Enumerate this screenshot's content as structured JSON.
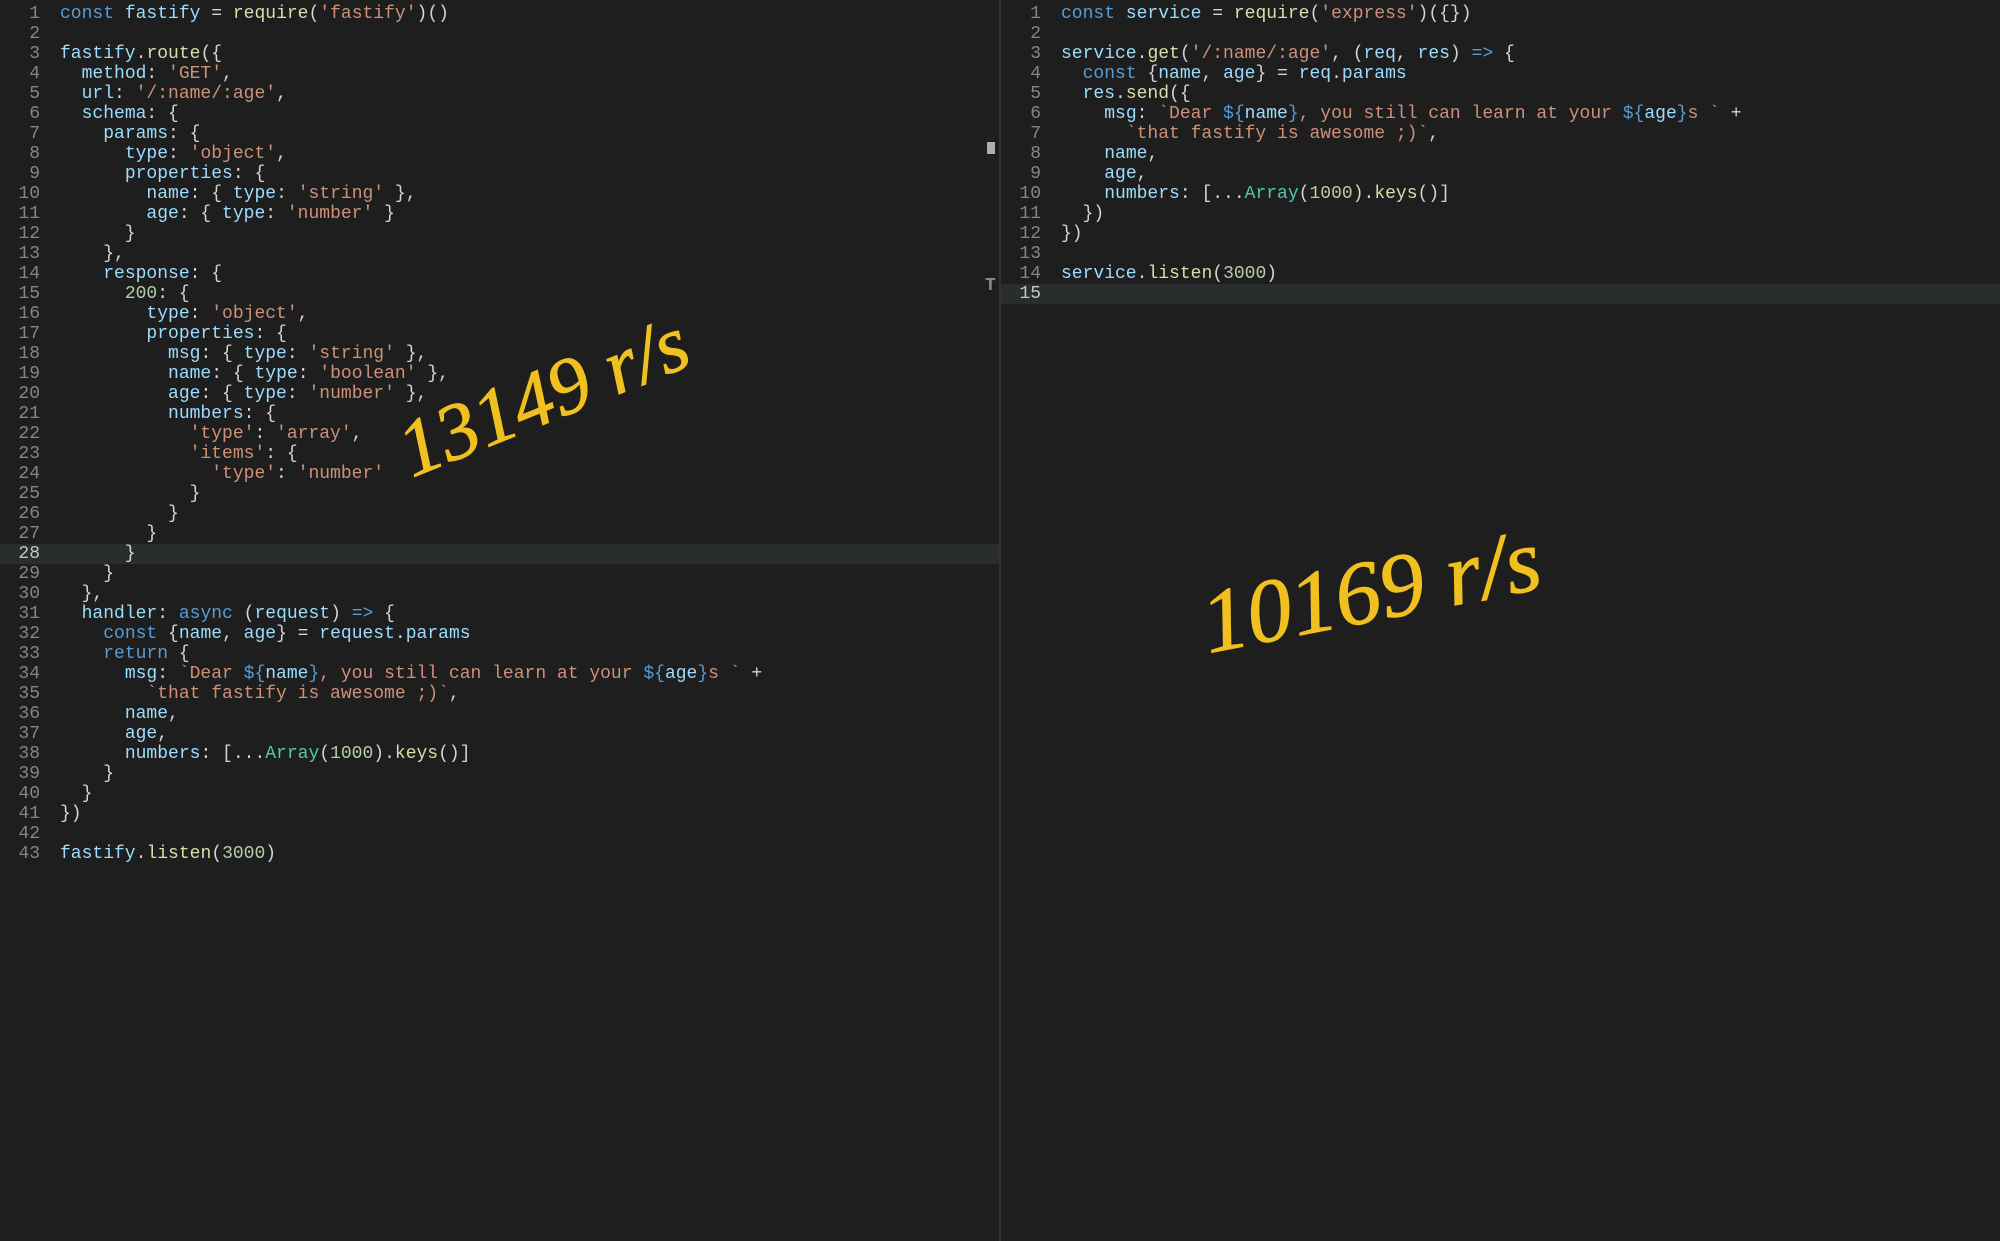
{
  "annotations": {
    "left": "13149 r/s",
    "right": "10169 r/s"
  },
  "left": {
    "highlight_line": 28,
    "lines": [
      [
        [
          "kw",
          "const"
        ],
        [
          "pun",
          " "
        ],
        [
          "var",
          "fastify"
        ],
        [
          "pun",
          " = "
        ],
        [
          "fn",
          "require"
        ],
        [
          "pun",
          "("
        ],
        [
          "str",
          "'fastify'"
        ],
        [
          "pun",
          ")()"
        ]
      ],
      [],
      [
        [
          "var",
          "fastify"
        ],
        [
          "pun",
          "."
        ],
        [
          "fn",
          "route"
        ],
        [
          "pun",
          "({"
        ]
      ],
      [
        [
          "pun",
          "  "
        ],
        [
          "var",
          "method"
        ],
        [
          "pun",
          ": "
        ],
        [
          "str",
          "'GET'"
        ],
        [
          "pun",
          ","
        ]
      ],
      [
        [
          "pun",
          "  "
        ],
        [
          "var",
          "url"
        ],
        [
          "pun",
          ": "
        ],
        [
          "str",
          "'/:name/:age'"
        ],
        [
          "pun",
          ","
        ]
      ],
      [
        [
          "pun",
          "  "
        ],
        [
          "var",
          "schema"
        ],
        [
          "pun",
          ": {"
        ]
      ],
      [
        [
          "pun",
          "    "
        ],
        [
          "var",
          "params"
        ],
        [
          "pun",
          ": {"
        ]
      ],
      [
        [
          "pun",
          "      "
        ],
        [
          "var",
          "type"
        ],
        [
          "pun",
          ": "
        ],
        [
          "str",
          "'object'"
        ],
        [
          "pun",
          ","
        ]
      ],
      [
        [
          "pun",
          "      "
        ],
        [
          "var",
          "properties"
        ],
        [
          "pun",
          ": {"
        ]
      ],
      [
        [
          "pun",
          "        "
        ],
        [
          "var",
          "name"
        ],
        [
          "pun",
          ": { "
        ],
        [
          "var",
          "type"
        ],
        [
          "pun",
          ": "
        ],
        [
          "str",
          "'string'"
        ],
        [
          "pun",
          " },"
        ]
      ],
      [
        [
          "pun",
          "        "
        ],
        [
          "var",
          "age"
        ],
        [
          "pun",
          ": { "
        ],
        [
          "var",
          "type"
        ],
        [
          "pun",
          ": "
        ],
        [
          "str",
          "'number'"
        ],
        [
          "pun",
          " }"
        ]
      ],
      [
        [
          "pun",
          "      }"
        ]
      ],
      [
        [
          "pun",
          "    },"
        ]
      ],
      [
        [
          "pun",
          "    "
        ],
        [
          "var",
          "response"
        ],
        [
          "pun",
          ": {"
        ]
      ],
      [
        [
          "pun",
          "      "
        ],
        [
          "num",
          "200"
        ],
        [
          "pun",
          ": {"
        ]
      ],
      [
        [
          "pun",
          "        "
        ],
        [
          "var",
          "type"
        ],
        [
          "pun",
          ": "
        ],
        [
          "str",
          "'object'"
        ],
        [
          "pun",
          ","
        ]
      ],
      [
        [
          "pun",
          "        "
        ],
        [
          "var",
          "properties"
        ],
        [
          "pun",
          ": {"
        ]
      ],
      [
        [
          "pun",
          "          "
        ],
        [
          "var",
          "msg"
        ],
        [
          "pun",
          ": { "
        ],
        [
          "var",
          "type"
        ],
        [
          "pun",
          ": "
        ],
        [
          "str",
          "'string'"
        ],
        [
          "pun",
          " },"
        ]
      ],
      [
        [
          "pun",
          "          "
        ],
        [
          "var",
          "name"
        ],
        [
          "pun",
          ": { "
        ],
        [
          "var",
          "type"
        ],
        [
          "pun",
          ": "
        ],
        [
          "str",
          "'boolean'"
        ],
        [
          "pun",
          " },"
        ]
      ],
      [
        [
          "pun",
          "          "
        ],
        [
          "var",
          "age"
        ],
        [
          "pun",
          ": { "
        ],
        [
          "var",
          "type"
        ],
        [
          "pun",
          ": "
        ],
        [
          "str",
          "'number'"
        ],
        [
          "pun",
          " },"
        ]
      ],
      [
        [
          "pun",
          "          "
        ],
        [
          "var",
          "numbers"
        ],
        [
          "pun",
          ": {"
        ]
      ],
      [
        [
          "pun",
          "            "
        ],
        [
          "str",
          "'type'"
        ],
        [
          "pun",
          ": "
        ],
        [
          "str",
          "'array'"
        ],
        [
          "pun",
          ","
        ]
      ],
      [
        [
          "pun",
          "            "
        ],
        [
          "str",
          "'items'"
        ],
        [
          "pun",
          ": {"
        ]
      ],
      [
        [
          "pun",
          "              "
        ],
        [
          "str",
          "'type'"
        ],
        [
          "pun",
          ": "
        ],
        [
          "str",
          "'number'"
        ]
      ],
      [
        [
          "pun",
          "            }"
        ]
      ],
      [
        [
          "pun",
          "          }"
        ]
      ],
      [
        [
          "pun",
          "        }"
        ]
      ],
      [
        [
          "pun",
          "      }"
        ]
      ],
      [
        [
          "pun",
          "    }"
        ]
      ],
      [
        [
          "pun",
          "  },"
        ]
      ],
      [
        [
          "pun",
          "  "
        ],
        [
          "var",
          "handler"
        ],
        [
          "pun",
          ": "
        ],
        [
          "kw",
          "async"
        ],
        [
          "pun",
          " ("
        ],
        [
          "var",
          "request"
        ],
        [
          "pun",
          ") "
        ],
        [
          "tpl",
          "=>"
        ],
        [
          "pun",
          " {"
        ]
      ],
      [
        [
          "pun",
          "    "
        ],
        [
          "kw",
          "const"
        ],
        [
          "pun",
          " {"
        ],
        [
          "var",
          "name"
        ],
        [
          "pun",
          ", "
        ],
        [
          "var",
          "age"
        ],
        [
          "pun",
          "} = "
        ],
        [
          "var",
          "request"
        ],
        [
          "pun",
          "."
        ],
        [
          "var",
          "params"
        ]
      ],
      [
        [
          "pun",
          "    "
        ],
        [
          "kw",
          "return"
        ],
        [
          "pun",
          " {"
        ]
      ],
      [
        [
          "pun",
          "      "
        ],
        [
          "var",
          "msg"
        ],
        [
          "pun",
          ": "
        ],
        [
          "str",
          "`Dear "
        ],
        [
          "tpl",
          "${"
        ],
        [
          "var",
          "name"
        ],
        [
          "tpl",
          "}"
        ],
        [
          "str",
          ", you still can learn at your "
        ],
        [
          "tpl",
          "${"
        ],
        [
          "var",
          "age"
        ],
        [
          "tpl",
          "}"
        ],
        [
          "str",
          "s `"
        ],
        [
          "pun",
          " +"
        ]
      ],
      [
        [
          "pun",
          "        "
        ],
        [
          "str",
          "`that fastify is awesome ;)`"
        ],
        [
          "pun",
          ","
        ]
      ],
      [
        [
          "pun",
          "      "
        ],
        [
          "var",
          "name"
        ],
        [
          "pun",
          ","
        ]
      ],
      [
        [
          "pun",
          "      "
        ],
        [
          "var",
          "age"
        ],
        [
          "pun",
          ","
        ]
      ],
      [
        [
          "pun",
          "      "
        ],
        [
          "var",
          "numbers"
        ],
        [
          "pun",
          ": [..."
        ],
        [
          "cls",
          "Array"
        ],
        [
          "pun",
          "("
        ],
        [
          "num",
          "1000"
        ],
        [
          "pun",
          ")."
        ],
        [
          "fn",
          "keys"
        ],
        [
          "pun",
          "()]"
        ]
      ],
      [
        [
          "pun",
          "    }"
        ]
      ],
      [
        [
          "pun",
          "  }"
        ]
      ],
      [
        [
          "pun",
          "})"
        ]
      ],
      [],
      [
        [
          "var",
          "fastify"
        ],
        [
          "pun",
          "."
        ],
        [
          "fn",
          "listen"
        ],
        [
          "pun",
          "("
        ],
        [
          "num",
          "3000"
        ],
        [
          "pun",
          ")"
        ]
      ]
    ]
  },
  "right": {
    "highlight_line": 15,
    "lines": [
      [
        [
          "kw",
          "const"
        ],
        [
          "pun",
          " "
        ],
        [
          "var",
          "service"
        ],
        [
          "pun",
          " = "
        ],
        [
          "fn",
          "require"
        ],
        [
          "pun",
          "("
        ],
        [
          "str",
          "'express'"
        ],
        [
          "pun",
          ")({})"
        ]
      ],
      [],
      [
        [
          "var",
          "service"
        ],
        [
          "pun",
          "."
        ],
        [
          "fn",
          "get"
        ],
        [
          "pun",
          "("
        ],
        [
          "str",
          "'/:name/:age'"
        ],
        [
          "pun",
          ", ("
        ],
        [
          "var",
          "req"
        ],
        [
          "pun",
          ", "
        ],
        [
          "var",
          "res"
        ],
        [
          "pun",
          ") "
        ],
        [
          "tpl",
          "=>"
        ],
        [
          "pun",
          " {"
        ]
      ],
      [
        [
          "pun",
          "  "
        ],
        [
          "kw",
          "const"
        ],
        [
          "pun",
          " {"
        ],
        [
          "var",
          "name"
        ],
        [
          "pun",
          ", "
        ],
        [
          "var",
          "age"
        ],
        [
          "pun",
          "} = "
        ],
        [
          "var",
          "req"
        ],
        [
          "pun",
          "."
        ],
        [
          "var",
          "params"
        ]
      ],
      [
        [
          "pun",
          "  "
        ],
        [
          "var",
          "res"
        ],
        [
          "pun",
          "."
        ],
        [
          "fn",
          "send"
        ],
        [
          "pun",
          "({"
        ]
      ],
      [
        [
          "pun",
          "    "
        ],
        [
          "var",
          "msg"
        ],
        [
          "pun",
          ": "
        ],
        [
          "str",
          "`Dear "
        ],
        [
          "tpl",
          "${"
        ],
        [
          "var",
          "name"
        ],
        [
          "tpl",
          "}"
        ],
        [
          "str",
          ", you still can learn at your "
        ],
        [
          "tpl",
          "${"
        ],
        [
          "var",
          "age"
        ],
        [
          "tpl",
          "}"
        ],
        [
          "str",
          "s `"
        ],
        [
          "pun",
          " +"
        ]
      ],
      [
        [
          "pun",
          "      "
        ],
        [
          "str",
          "`that fastify is awesome ;)`"
        ],
        [
          "pun",
          ","
        ]
      ],
      [
        [
          "pun",
          "    "
        ],
        [
          "var",
          "name"
        ],
        [
          "pun",
          ","
        ]
      ],
      [
        [
          "pun",
          "    "
        ],
        [
          "var",
          "age"
        ],
        [
          "pun",
          ","
        ]
      ],
      [
        [
          "pun",
          "    "
        ],
        [
          "var",
          "numbers"
        ],
        [
          "pun",
          ": [..."
        ],
        [
          "cls",
          "Array"
        ],
        [
          "pun",
          "("
        ],
        [
          "num",
          "1000"
        ],
        [
          "pun",
          ")."
        ],
        [
          "fn",
          "keys"
        ],
        [
          "pun",
          "()]"
        ]
      ],
      [
        [
          "pun",
          "  })"
        ]
      ],
      [
        [
          "pun",
          "})"
        ]
      ],
      [],
      [
        [
          "var",
          "service"
        ],
        [
          "pun",
          "."
        ],
        [
          "fn",
          "listen"
        ],
        [
          "pun",
          "("
        ],
        [
          "num",
          "3000"
        ],
        [
          "pun",
          ")"
        ]
      ],
      []
    ]
  }
}
